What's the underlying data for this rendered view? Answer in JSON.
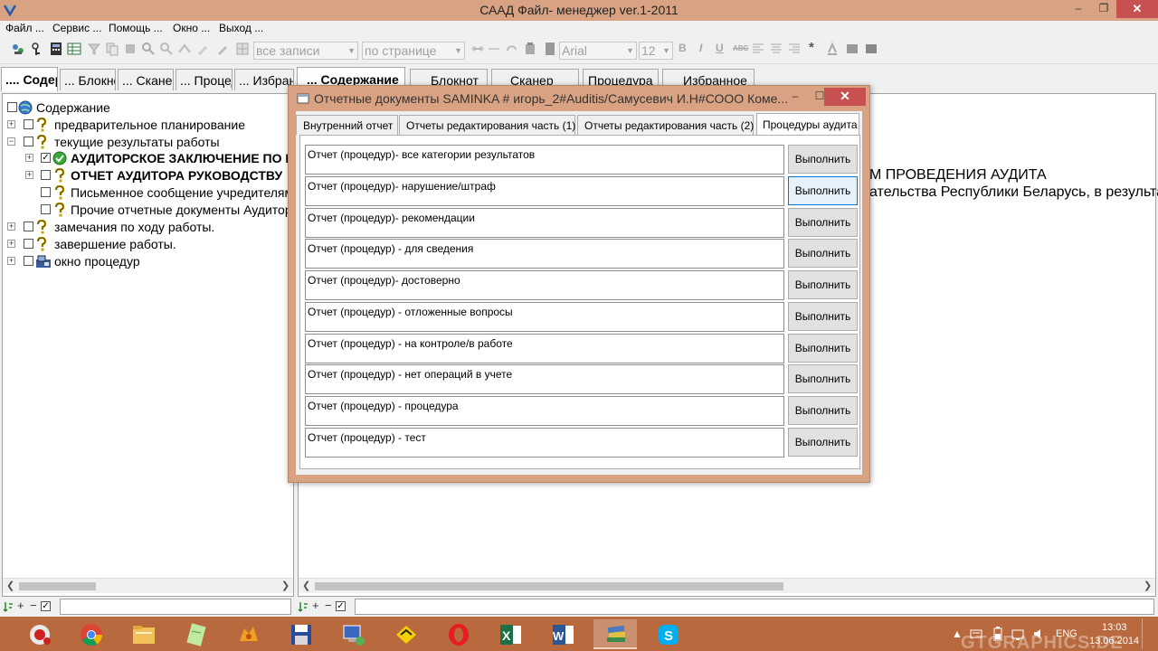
{
  "window": {
    "title": "САAД Файл- менеджер ver.1-2011",
    "minimize_glyph": "–",
    "restore_glyph": "❐",
    "close_glyph": "✕"
  },
  "menu": {
    "items": [
      "Файл ...",
      "Сервис ...",
      "Помощь ...",
      "Окно ...",
      "Выход ..."
    ]
  },
  "toolbar": {
    "records_combo": "все записи",
    "page_combo": "по странице",
    "font_combo": "Arial",
    "size_combo": "12",
    "bold": "B",
    "italic": "I",
    "underline": "U",
    "strike": "ABC",
    "star": "*"
  },
  "left_tabs": [
    {
      "label": ".... Содержание",
      "active": true
    },
    {
      "label": "... Блокнот",
      "active": false
    },
    {
      "label": "... Сканер",
      "active": false
    },
    {
      "label": "... Процедура",
      "active": false
    },
    {
      "label": "... Избранное",
      "active": false
    }
  ],
  "right_tabs": [
    {
      "label": "... Содержание",
      "active": true
    },
    {
      "label": "Блокнот",
      "active": false
    },
    {
      "label": "Сканер",
      "active": false
    },
    {
      "label": "Процедура",
      "active": false
    },
    {
      "label": "Избранное",
      "active": false
    }
  ],
  "tree": {
    "root": "Содержание",
    "items": [
      {
        "label": "предварительное планирование",
        "bold": false
      },
      {
        "label": "текущие результаты работы",
        "bold": false
      },
      {
        "label": "АУДИТОРСКОЕ ЗАКЛЮЧЕНИЕ ПО РЕЗУЛЬТАТАМ",
        "bold": true
      },
      {
        "label": "ОТЧЕТ АУДИТОРА РУКОВОДСТВУ",
        "bold": true
      },
      {
        "label": "Письменное сообщение учредителям",
        "bold": false
      },
      {
        "label": "Прочие отчетные документы Аудитора",
        "bold": false
      },
      {
        "label": "замечания по ходу работы.",
        "bold": false
      },
      {
        "label": "завершение работы.",
        "bold": false
      },
      {
        "label": "окно процедур",
        "bold": false
      }
    ]
  },
  "right_content": {
    "line1": "М ПРОВЕДЕНИЯ АУДИТА",
    "line2": "ательства Республики Беларусь, в результате"
  },
  "status": {
    "plus": "+",
    "minus": "−",
    "check": "✓"
  },
  "dialog": {
    "title": "Отчетные документы SAMINKA # игорь_2#Auditis/Самусевич И.Н#СООО Коме...",
    "minimize_glyph": "–",
    "restore_glyph": "☐",
    "close_glyph": "✕",
    "tabs": [
      {
        "label": "Внутренний отчет",
        "active": false
      },
      {
        "label": "Отчеты редактирования часть (1)",
        "active": false
      },
      {
        "label": "Отчеты редактирования часть (2)",
        "active": false
      },
      {
        "label": "Процедуры аудита",
        "active": true
      }
    ],
    "reports": [
      {
        "text": "Отчет (процедур)- все категории результатов",
        "button": "Выполнить"
      },
      {
        "text": "Отчет (процедур)- нарушение/штраф",
        "button": "Выполнить"
      },
      {
        "text": "Отчет (процедур)- рекомендации",
        "button": "Выполнить"
      },
      {
        "text": "Отчет (процедур) - для сведения",
        "button": "Выполнить"
      },
      {
        "text": "Отчет (процедур)- достоверно",
        "button": "Выполнить"
      },
      {
        "text": "Отчет (процедур) - отложенные вопросы",
        "button": "Выполнить"
      },
      {
        "text": "Отчет (процедур) - на контроле/в работе",
        "button": "Выполнить"
      },
      {
        "text": "Отчет (процедур) - нет операций в учете",
        "button": "Выполнить"
      },
      {
        "text": "Отчет (процедур) - процедура",
        "button": "Выполнить"
      },
      {
        "text": "Отчет (процедур) - тест",
        "button": "Выполнить"
      }
    ],
    "hovered_index": 1
  },
  "taskbar": {
    "apps": [
      "recorder",
      "chrome",
      "explorer",
      "notepad",
      "filezilla",
      "save",
      "network",
      "yellow-app",
      "opera",
      "excel",
      "word",
      "books",
      "skype"
    ],
    "active_index": 11,
    "lang": "ENG",
    "time": "13:03",
    "date": "13.06.2014",
    "watermark": "GTGRAPHICS.DE"
  },
  "colors": {
    "title_bar": "#d9a383",
    "taskbar": "#b86a3e",
    "close_button": "#c75050"
  }
}
